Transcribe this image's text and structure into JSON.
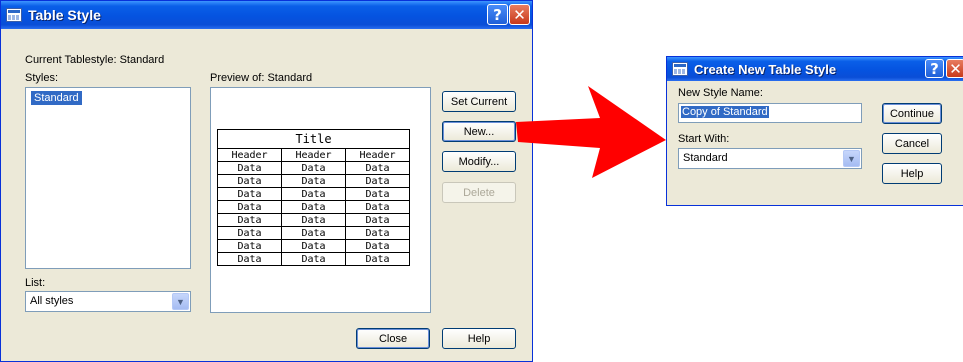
{
  "table_style": {
    "title": "Table Style",
    "current_label": "Current Tablestyle: Standard",
    "styles_label": "Styles:",
    "styles": [
      "Standard"
    ],
    "list_label": "List:",
    "list_value": "All styles",
    "preview_label": "Preview of: Standard",
    "preview": {
      "title": "Title",
      "headers": [
        "Header",
        "Header",
        "Header"
      ],
      "cell": "Data"
    },
    "buttons": {
      "set_current": "Set Current",
      "new": "New...",
      "modify": "Modify...",
      "delete": "Delete",
      "close": "Close",
      "help": "Help"
    },
    "help_icon": "?",
    "close_icon": "✕"
  },
  "create_new": {
    "title": "Create New Table Style",
    "name_label": "New Style Name:",
    "name_value": "Copy of Standard",
    "start_label": "Start With:",
    "start_value": "Standard",
    "buttons": {
      "continue": "Continue",
      "cancel": "Cancel",
      "help": "Help"
    },
    "help_icon": "?",
    "close_icon": "✕"
  },
  "colors": {
    "titlebar": "#0553e0",
    "arrow": "#ff0000",
    "selection": "#316ac5",
    "dialog_bg": "#ece9d8"
  }
}
